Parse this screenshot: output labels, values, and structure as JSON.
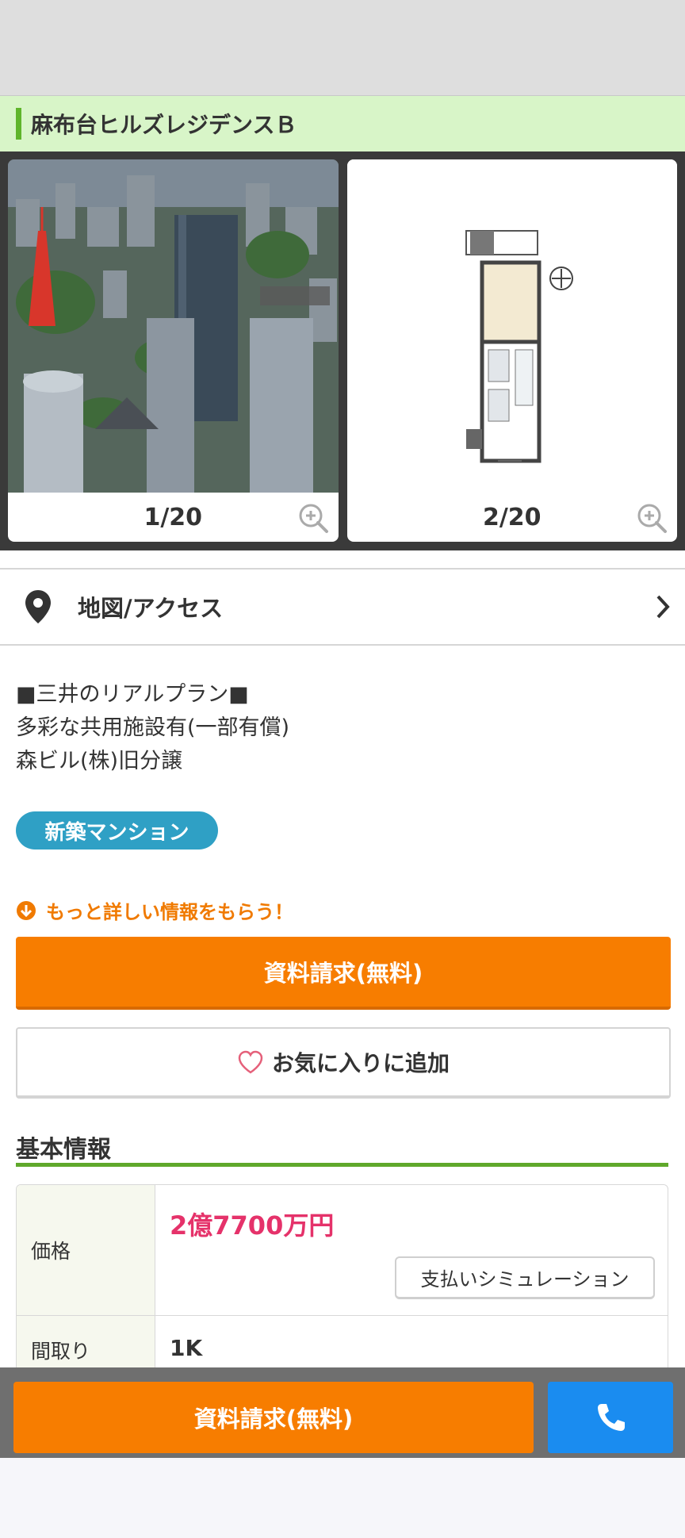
{
  "property": {
    "title": "麻布台ヒルズレジデンスＢ"
  },
  "gallery": {
    "images": [
      {
        "caption": "1/20",
        "type": "aerial-photo"
      },
      {
        "caption": "2/20",
        "type": "floor-plan"
      }
    ]
  },
  "access": {
    "label": "地図/アクセス"
  },
  "description": {
    "lines": [
      "■三井のリアルプラン■",
      "多彩な共用施設有(一部有償)",
      "森ビル(株)旧分譲"
    ]
  },
  "badge": {
    "label": "新築マンション"
  },
  "cta": {
    "more_info": "もっと詳しい情報をもらう！",
    "request_label": "資料請求(無料)",
    "favorite_label": "お気に入りに追加"
  },
  "basic_info": {
    "title": "基本情報",
    "price_label": "価格",
    "price_value": "2億7700万円",
    "simulation_label": "支払いシミュレーション",
    "layout_label": "間取り",
    "layout_value": "1K"
  },
  "bottom_bar": {
    "request_label": "資料請求(無料)"
  },
  "colors": {
    "accent_orange": "#f77d00",
    "title_bar_bg": "#d8f5c8",
    "badge_blue": "#2fa0c5",
    "price_pink": "#e5326a",
    "call_blue": "#1a8cf0"
  },
  "icons": [
    "zoom-in-icon",
    "map-pin-icon",
    "chevron-right-icon",
    "arrow-down-circle-icon",
    "heart-icon",
    "phone-icon"
  ]
}
